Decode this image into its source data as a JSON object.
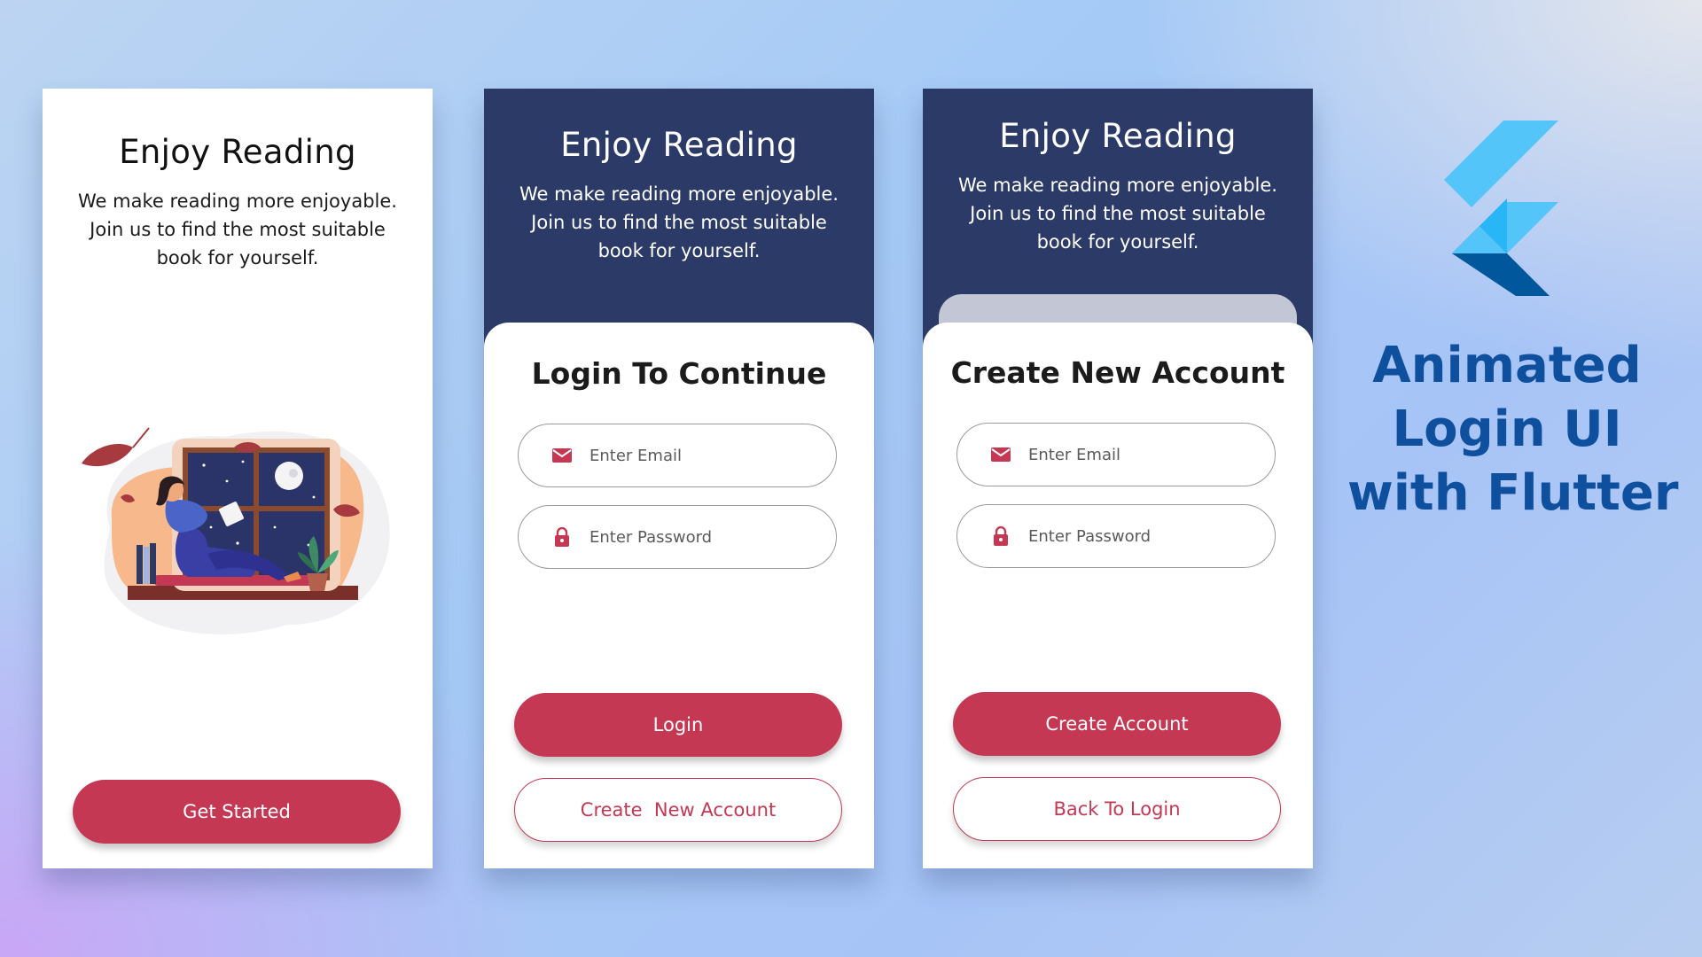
{
  "colors": {
    "navy": "#2c3a67",
    "accent": "#c43853",
    "promo_text": "#0e4f9e",
    "flutter_light": "#54c5f8",
    "flutter_dark": "#01579b"
  },
  "intro_screen": {
    "title": "Enjoy Reading",
    "description": "We make reading more enjoyable. Join us to find the most suitable book for yourself.",
    "illustration": "woman-reading-by-window",
    "get_started_label": "Get Started"
  },
  "login_screen": {
    "title": "Enjoy Reading",
    "description": "We make reading more enjoyable. Join us to find the most suitable book for yourself.",
    "form_title": "Login To Continue",
    "email": {
      "icon": "email-icon",
      "placeholder": "Enter Email",
      "value": ""
    },
    "password": {
      "icon": "lock-icon",
      "placeholder": "Enter Password",
      "value": ""
    },
    "login_label": "Login",
    "create_account_label": "Create  New Account"
  },
  "register_screen": {
    "title": "Enjoy Reading",
    "description": "We make reading more enjoyable. Join us to find the most suitable book for yourself.",
    "form_title": "Create New Account",
    "email": {
      "icon": "email-icon",
      "placeholder": "Enter Email",
      "value": ""
    },
    "password": {
      "icon": "lock-icon",
      "placeholder": "Enter Password",
      "value": ""
    },
    "create_account_label": "Create Account",
    "back_to_login_label": "Back To Login"
  },
  "promo": {
    "logo": "flutter-logo",
    "line1": "Animated",
    "line2": "Login UI",
    "line3": "with Flutter"
  }
}
